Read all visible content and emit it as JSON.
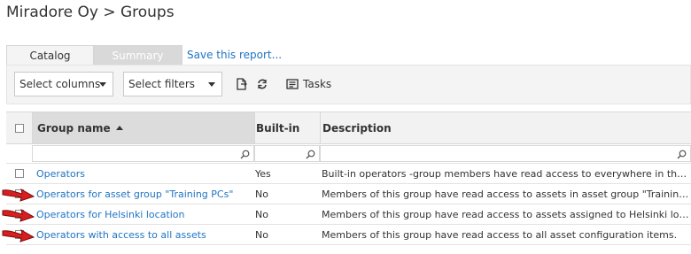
{
  "header": {
    "title": "Miradore Oy > Groups"
  },
  "tabs": [
    {
      "label": "Catalog"
    },
    {
      "label": "Summary"
    }
  ],
  "save_report_link": "Save this report...",
  "toolbar": {
    "columns_select": "Select columns",
    "filters_select": "Select filters",
    "tasks_label": "Tasks"
  },
  "table": {
    "columns": [
      "Group name",
      "Built-in",
      "Description"
    ],
    "sort": {
      "column": "Group name",
      "direction": "ascending"
    },
    "rows": [
      {
        "name": "Operators",
        "built_in": "Yes",
        "description": "Built-in operators -group members have read access to everywhere in the syst..."
      },
      {
        "name": "Operators for asset group \"Training PCs\"",
        "built_in": "No",
        "description": "Members of this group have read access to assets in asset group \"Training PCs\"."
      },
      {
        "name": "Operators for Helsinki location",
        "built_in": "No",
        "description": "Members of this group have read access to assets assigned to Helsinki location."
      },
      {
        "name": "Operators with access to all assets",
        "built_in": "No",
        "description": "Members of this group have read access to all asset configuration items."
      }
    ]
  },
  "colors": {
    "link": "#1f74c4",
    "arrow": "#d81e1e",
    "header_sorted_bg": "#dcdcdc"
  }
}
